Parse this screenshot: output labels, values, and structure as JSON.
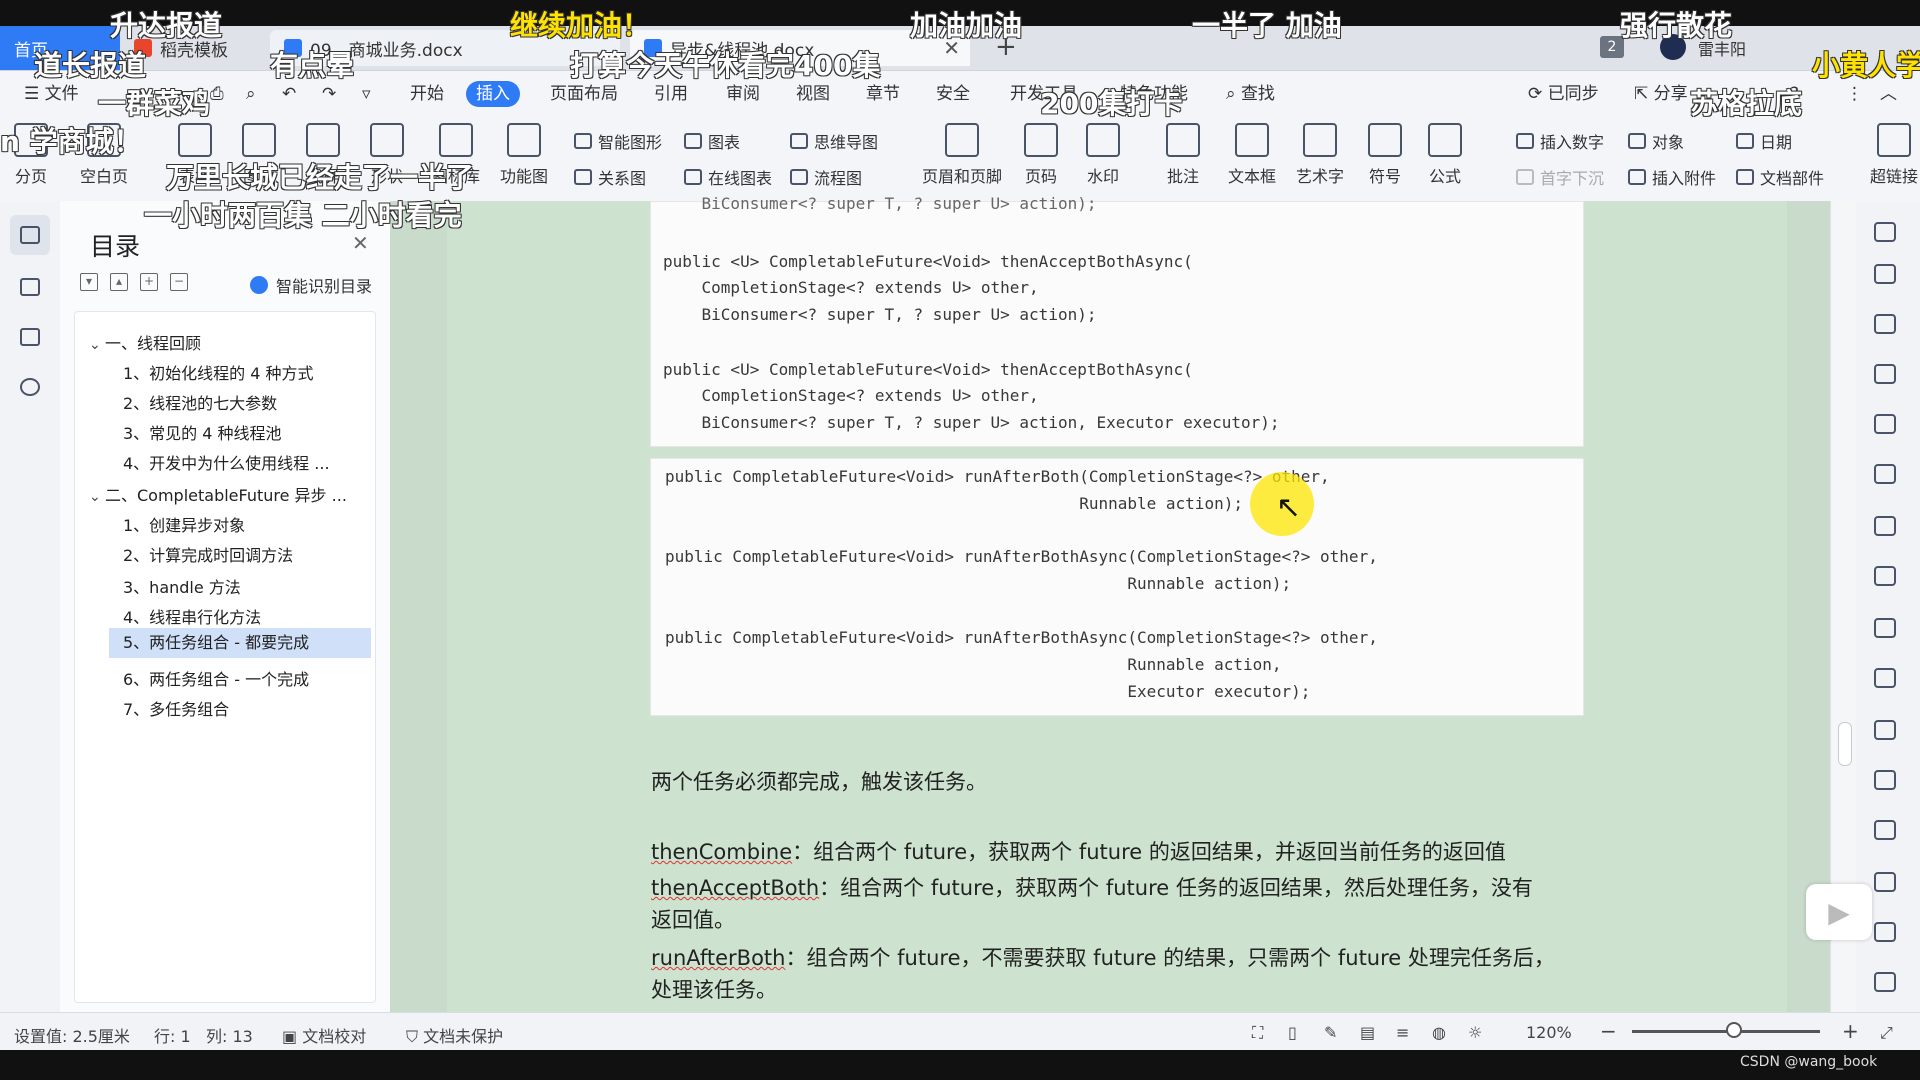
{
  "tabs": {
    "home": "首页",
    "template": "稻壳模板",
    "doc1": "09、商城业务.docx",
    "doc2": "异步&线程池.docx",
    "add": "+"
  },
  "account": {
    "badge": "2",
    "name": "雷丰阳"
  },
  "menu": {
    "file": "文件",
    "items": [
      "开始",
      "插入",
      "页面布局",
      "引用",
      "审阅",
      "视图",
      "章节",
      "安全",
      "开发工具",
      "特色功能"
    ],
    "active": "插入",
    "search": "查找",
    "synced": "已同步",
    "share": "分享",
    "help": "?"
  },
  "ribbon": {
    "big": [
      "分页",
      "空白页",
      "表格",
      "图片",
      "截屏",
      "形状",
      "图标库",
      "功能图"
    ],
    "small": [
      "智能图形",
      "图表",
      "思维导图",
      "关系图",
      "在线图表",
      "流程图"
    ],
    "big2": [
      "页眉和页脚",
      "页码",
      "水印",
      "批注",
      "文本框",
      "艺术字",
      "符号",
      "公式"
    ],
    "small2": [
      "插入数字",
      "对象",
      "日期",
      "首字下沉",
      "插入附件",
      "文档部件"
    ],
    "last": "超链接"
  },
  "toc": {
    "title": "目录",
    "smart": "智能识别目录",
    "items": [
      {
        "label": "一、线程回顾",
        "level": 1
      },
      {
        "label": "1、初始化线程的 4 种方式",
        "level": 2
      },
      {
        "label": "2、线程池的七大参数",
        "level": 2
      },
      {
        "label": "3、常见的 4 种线程池",
        "level": 2
      },
      {
        "label": "4、开发中为什么使用线程 ...",
        "level": 2
      },
      {
        "label": "二、CompletableFuture 异步 ...",
        "level": 1
      },
      {
        "label": "1、创建异步对象",
        "level": 2
      },
      {
        "label": "2、计算完成时回调方法",
        "level": 2
      },
      {
        "label": "3、handle 方法",
        "level": 2
      },
      {
        "label": "4、线程串行化方法",
        "level": 2
      },
      {
        "label": "5、两任务组合 - 都要完成",
        "level": 2,
        "selected": true
      },
      {
        "label": "6、两任务组合 - 一个完成",
        "level": 2
      },
      {
        "label": "7、多任务组合",
        "level": 2
      }
    ]
  },
  "code1": [
    "    BiConsumer<? super T, ? super U> action);",
    "public <U> CompletableFuture<Void> thenAcceptBothAsync(",
    "    CompletionStage<? extends U> other,",
    "    BiConsumer<? super T, ? super U> action);",
    "public <U> CompletableFuture<Void> thenAcceptBothAsync(",
    "    CompletionStage<? extends U> other,",
    "    BiConsumer<? super T, ? super U> action, Executor executor);"
  ],
  "code2": [
    "public CompletableFuture<Void> runAfterBoth(CompletionStage<?> other,",
    "                                           Runnable action);",
    "public CompletableFuture<Void> runAfterBothAsync(CompletionStage<?> other,",
    "                                                Runnable action);",
    "public CompletableFuture<Void> runAfterBothAsync(CompletionStage<?> other,",
    "                                                Runnable action,",
    "                                                Executor executor);"
  ],
  "paragraphs": {
    "p1": "两个任务必须都完成，触发该任务。",
    "t1": "thenCombine",
    "d1": "：组合两个 future，获取两个 future 的返回结果，并返回当前任务的返回值",
    "t2": "thenAcceptBoth",
    "d2": "：组合两个 future，获取两个 future 任务的返回结果，然后处理任务，没有",
    "d2b": "返回值。",
    "t3": "runAfterBoth",
    "d3": "：组合两个 future，不需要获取 future 的结果，只需两个 future 处理完任务后，",
    "d3b": "处理该任务。"
  },
  "status": {
    "setting": "设置值: 2.5厘米",
    "row": "行: 1",
    "col": "列: 13",
    "proof": "文档校对",
    "protect": "文档未保护",
    "zoom": "120%",
    "minus": "−",
    "plus": "+"
  },
  "watermark": "CSDN @wang_book",
  "danmaku": [
    {
      "text": "升达报道",
      "yellow": false
    },
    {
      "text": "继续加油！",
      "yellow": true
    },
    {
      "text": "加油加油",
      "yellow": false
    },
    {
      "text": "一半了 加油",
      "yellow": false
    },
    {
      "text": "强行散花",
      "yellow": false
    },
    {
      "text": "道长报道",
      "yellow": false
    },
    {
      "text": "有点晕",
      "yellow": false
    },
    {
      "text": "打算今天午休看完400集",
      "yellow": false
    },
    {
      "text": "小黄人学",
      "yellow": true
    },
    {
      "text": "一群菜鸡",
      "yellow": false
    },
    {
      "text": "200集打卡",
      "yellow": false
    },
    {
      "text": "苏格拉底",
      "yellow": false
    },
    {
      "text": "n 学商城！",
      "yellow": false
    },
    {
      "text": "万里长城已经走了一半了",
      "yellow": false
    },
    {
      "text": "一小时两百集   二小时看完",
      "yellow": false
    }
  ]
}
